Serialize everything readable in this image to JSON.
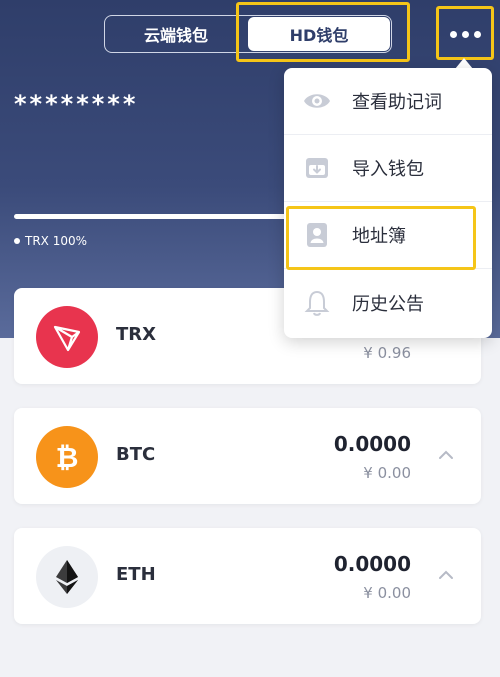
{
  "header": {
    "tabs": [
      {
        "label": "云端钱包",
        "active": false
      },
      {
        "label": "HD钱包",
        "active": true
      }
    ],
    "masked_balance": "********",
    "allocation_label": "TRX 100%",
    "allocation_progress": 1.0
  },
  "menu": {
    "items": [
      {
        "label": "查看助记词",
        "icon": "eye-icon"
      },
      {
        "label": "导入钱包",
        "icon": "import-wallet-icon"
      },
      {
        "label": "地址簿",
        "icon": "address-book-icon"
      },
      {
        "label": "历史公告",
        "icon": "bell-icon"
      }
    ]
  },
  "assets": [
    {
      "symbol": "TRX",
      "amount": "",
      "cny": "¥ 0.96",
      "icon": "trx-icon",
      "color": "#e8344e"
    },
    {
      "symbol": "BTC",
      "amount": "0.0000",
      "cny": "¥ 0.00",
      "icon": "btc-icon",
      "color": "#f7931a"
    },
    {
      "symbol": "ETH",
      "amount": "0.0000",
      "cny": "¥ 0.00",
      "icon": "eth-icon",
      "color": "#eef0f4"
    }
  ],
  "colors": {
    "header_dark": "#2f3e6a",
    "highlight": "#f5c518",
    "text_primary": "#2b2f3c",
    "text_secondary": "#8b90a0"
  }
}
